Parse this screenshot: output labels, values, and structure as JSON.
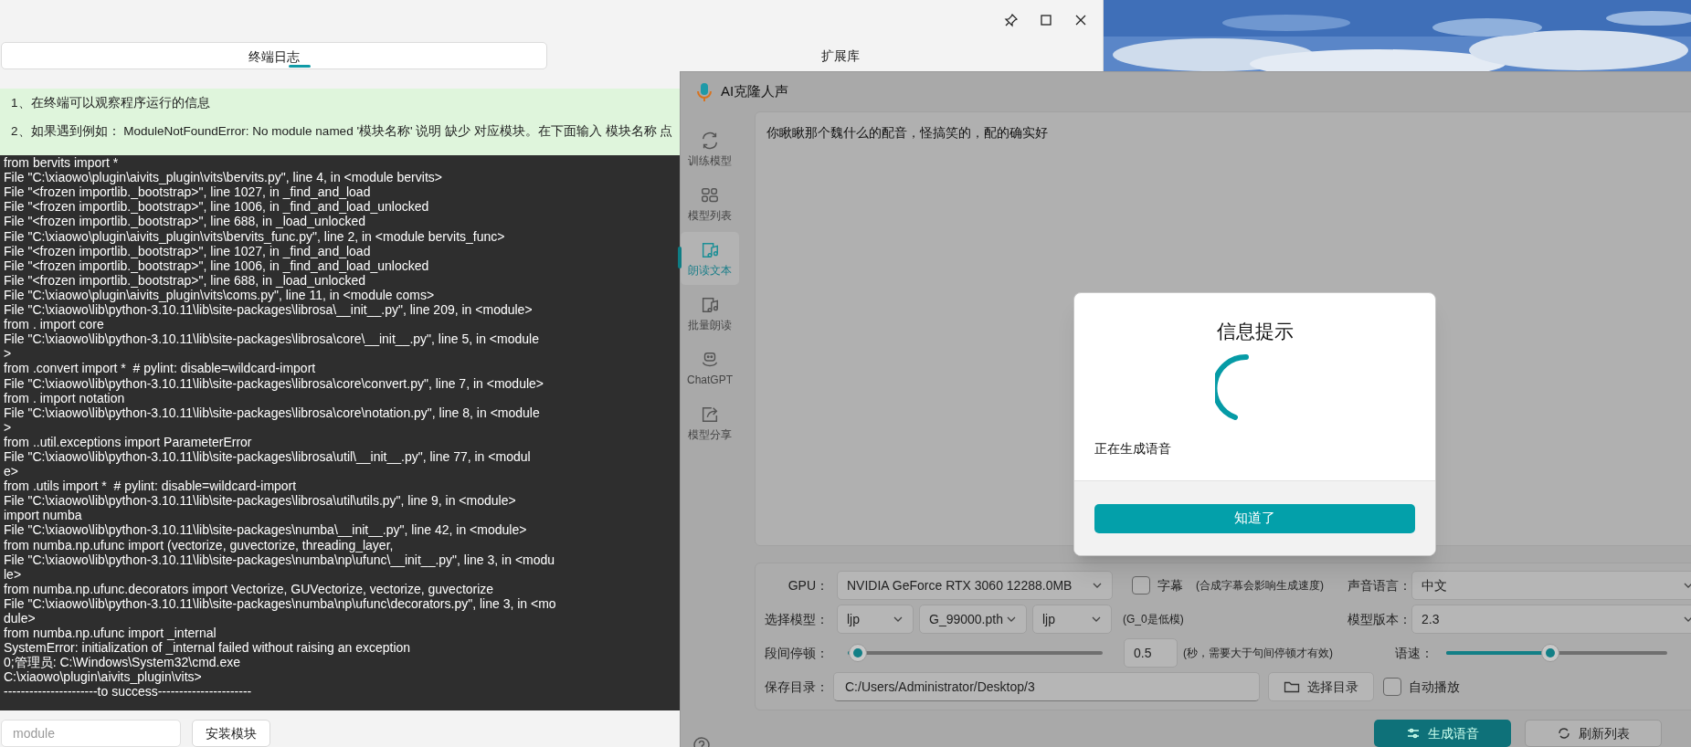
{
  "terminal_window": {
    "tabs": [
      {
        "label": "终端日志",
        "selected": true
      },
      {
        "label": "扩展库",
        "selected": false
      }
    ],
    "info_lines": [
      "1、在终端可以观察程序运行的信息",
      "2、如果遇到例如： ModuleNotFoundError: No module named '模块名称' 说明 缺少 对应模块。在下面输入 模块名称 点"
    ],
    "terminal_lines": [
      "from bervits import *",
      "File \"C:\\xiaowo\\plugin\\aivits_plugin\\vits\\bervits.py\", line 4, in <module bervits>",
      "File \"<frozen importlib._bootstrap>\", line 1027, in _find_and_load",
      "File \"<frozen importlib._bootstrap>\", line 1006, in _find_and_load_unlocked",
      "File \"<frozen importlib._bootstrap>\", line 688, in _load_unlocked",
      "File \"C:\\xiaowo\\plugin\\aivits_plugin\\vits\\bervits_func.py\", line 2, in <module bervits_func>",
      "File \"<frozen importlib._bootstrap>\", line 1027, in _find_and_load",
      "File \"<frozen importlib._bootstrap>\", line 1006, in _find_and_load_unlocked",
      "File \"<frozen importlib._bootstrap>\", line 688, in _load_unlocked",
      "File \"C:\\xiaowo\\plugin\\aivits_plugin\\vits\\coms.py\", line 11, in <module coms>",
      "File \"C:\\xiaowo\\lib\\python-3.10.11\\lib\\site-packages\\librosa\\__init__.py\", line 209, in <module>",
      "from . import core",
      "File \"C:\\xiaowo\\lib\\python-3.10.11\\lib\\site-packages\\librosa\\core\\__init__.py\", line 5, in <module",
      ">",
      "from .convert import *  # pylint: disable=wildcard-import",
      "File \"C:\\xiaowo\\lib\\python-3.10.11\\lib\\site-packages\\librosa\\core\\convert.py\", line 7, in <module>",
      "from . import notation",
      "File \"C:\\xiaowo\\lib\\python-3.10.11\\lib\\site-packages\\librosa\\core\\notation.py\", line 8, in <module",
      ">",
      "from ..util.exceptions import ParameterError",
      "File \"C:\\xiaowo\\lib\\python-3.10.11\\lib\\site-packages\\librosa\\util\\__init__.py\", line 77, in <modul",
      "e>",
      "from .utils import *  # pylint: disable=wildcard-import",
      "File \"C:\\xiaowo\\lib\\python-3.10.11\\lib\\site-packages\\librosa\\util\\utils.py\", line 9, in <module>",
      "import numba",
      "File \"C:\\xiaowo\\lib\\python-3.10.11\\lib\\site-packages\\numba\\__init__.py\", line 42, in <module>",
      "from numba.np.ufunc import (vectorize, guvectorize, threading_layer,",
      "File \"C:\\xiaowo\\lib\\python-3.10.11\\lib\\site-packages\\numba\\np\\ufunc\\__init__.py\", line 3, in <modu",
      "le>",
      "from numba.np.ufunc.decorators import Vectorize, GUVectorize, vectorize, guvectorize",
      "File \"C:\\xiaowo\\lib\\python-3.10.11\\lib\\site-packages\\numba\\np\\ufunc\\decorators.py\", line 3, in <mo",
      "dule>",
      "from numba.np.ufunc import _internal",
      "SystemError: initialization of _internal failed without raising an exception",
      "0;管理员: C:\\Windows\\System32\\cmd.exe",
      "C:\\xiaowo\\plugin\\aivits_plugin\\vits>",
      "----------------------to success----------------------"
    ],
    "module_field": {
      "placeholder": "module"
    },
    "install_button": "安装模块"
  },
  "app": {
    "title": "AI克隆人声",
    "sidebar": [
      {
        "label": "训练模型",
        "selected": false
      },
      {
        "label": "模型列表",
        "selected": false
      },
      {
        "label": "朗读文本",
        "selected": true
      },
      {
        "label": "批量朗读",
        "selected": false
      },
      {
        "label": "ChatGPT",
        "selected": false
      },
      {
        "label": "模型分享",
        "selected": false
      }
    ],
    "text_input": {
      "value": "你瞅瞅那个魏什么的配音，怪搞笑的，配的确实好"
    },
    "gpu": {
      "label": "GPU：",
      "value": "NVIDIA GeForce RTX 3060 12288.0MB"
    },
    "subtitle": {
      "label": "字幕",
      "checked": false,
      "note": "(合成字幕会影响生成速度)"
    },
    "voice_language": {
      "label": "声音语言：",
      "value": "中文"
    },
    "model": {
      "label": "选择模型：",
      "values": [
        "ljp",
        "G_99000.pth",
        "ljp"
      ],
      "note": "(G_0是低模)"
    },
    "model_version": {
      "label": "模型版本：",
      "value": "2.3"
    },
    "pause": {
      "label": "段间停顿：",
      "level": 0.04,
      "value": "0.5",
      "note": "(秒，需要大于句间停顿才有效)"
    },
    "speed": {
      "label": "语速：",
      "level": 0.47
    },
    "save_dir": {
      "label": "保存目录：",
      "value": "C:/Users/Administrator/Desktop/3",
      "button": "选择目录"
    },
    "autoplay": {
      "label": "自动播放",
      "checked": false
    },
    "actions": [
      "生成语音",
      "刷新列表"
    ]
  },
  "dialog": {
    "title": "信息提示",
    "message": "正在生成语音",
    "button": "知道了"
  }
}
